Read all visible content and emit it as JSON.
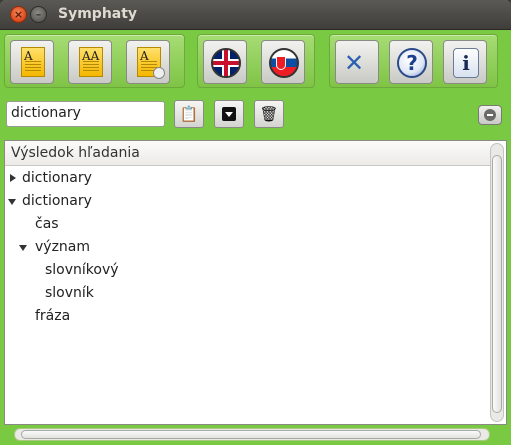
{
  "window": {
    "title": "Symphaty"
  },
  "toolbar": {
    "icons": [
      "document-a-icon",
      "document-aa-icon",
      "document-clock-icon",
      "english-flag-icon",
      "slovak-flag-icon",
      "tools-icon",
      "help-icon",
      "info-icon"
    ],
    "help_glyph": "?",
    "info_glyph": "i",
    "doc_a": "A",
    "doc_aa": "AA",
    "doc_clock": "A"
  },
  "search": {
    "value": "dictionary"
  },
  "results": {
    "header": "Výsledok hľadania",
    "items": [
      {
        "label": "dictionary",
        "state": "collapsed",
        "level": 0
      },
      {
        "label": "dictionary",
        "state": "expanded",
        "level": 0
      },
      {
        "label": "čas",
        "state": "leaf",
        "level": 1
      },
      {
        "label": "význam",
        "state": "expanded",
        "level": 1
      },
      {
        "label": "slovníkový",
        "state": "leaf",
        "level": 2
      },
      {
        "label": "slovník",
        "state": "leaf",
        "level": 2
      },
      {
        "label": "fráza",
        "state": "leaf",
        "level": 1
      }
    ]
  },
  "colors": {
    "window_bg": "#7ac943",
    "titlebar": "#3f3e3a",
    "close_button": "#d9471b"
  }
}
